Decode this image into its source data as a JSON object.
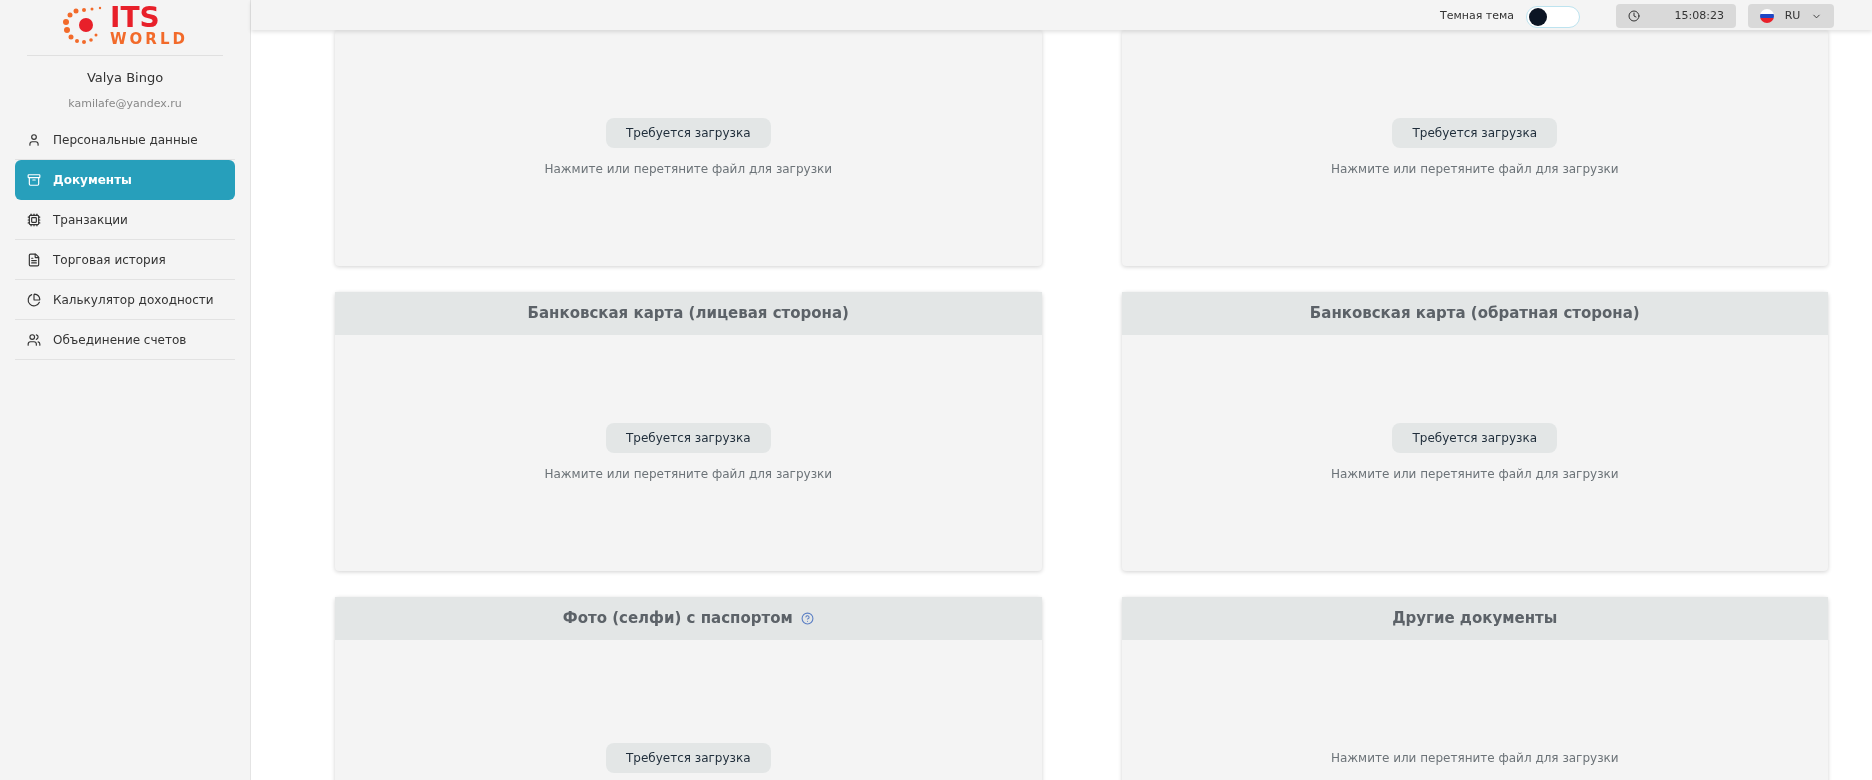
{
  "logo": {
    "line_1": "ITS",
    "line_2": "WORLD"
  },
  "user": {
    "name": "Valya  Bingo",
    "email": "kamilafe@yandex.ru"
  },
  "sidebar": {
    "items": [
      {
        "label": "Персональные данные",
        "selected": false
      },
      {
        "label": "Документы",
        "selected": true
      },
      {
        "label": "Транзакции",
        "selected": false
      },
      {
        "label": "Торговая история",
        "selected": false
      },
      {
        "label": "Калькулятор доходности",
        "selected": false
      },
      {
        "label": "Объединение счетов",
        "selected": false
      }
    ]
  },
  "top_bar": {
    "theme_toggle": {
      "label": "Темная тема",
      "on": false
    },
    "clock": "15:08:23",
    "language": "RU"
  },
  "documents": [
    {
      "status": "Требуется загрузка",
      "hint": "Нажмите или перетяните файл для загрузки"
    },
    {
      "status": "Требуется загрузка",
      "hint": "Нажмите или перетяните файл для загрузки"
    },
    {
      "title": "Банковская карта (лицевая сторона)",
      "status": "Требуется загрузка",
      "hint": "Нажмите или перетяните файл для загрузки"
    },
    {
      "title": "Банковская карта (обратная сторона)",
      "status": "Требуется загрузка",
      "hint": "Нажмите или перетяните файл для загрузки"
    },
    {
      "title": "Фото (селфи) с паспортом",
      "help": true,
      "status": "Требуется загрузка"
    },
    {
      "title": "Другие документы",
      "hint": "Нажмите или перетяните файл для загрузки"
    }
  ]
}
